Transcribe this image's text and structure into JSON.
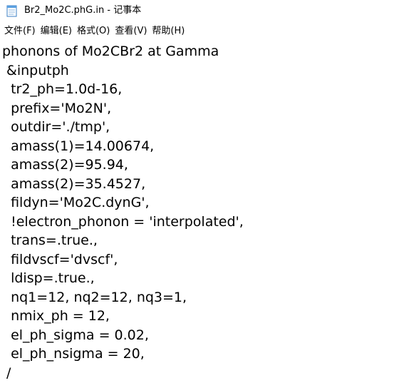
{
  "window": {
    "title": "Br2_Mo2C.phG.in - 记事本",
    "icon": "notepad-icon"
  },
  "menu": [
    {
      "label": "文件(F)"
    },
    {
      "label": "编辑(E)"
    },
    {
      "label": "格式(O)"
    },
    {
      "label": "查看(V)"
    },
    {
      "label": "帮助(H)"
    }
  ],
  "document": {
    "lines": [
      "phonons of Mo2CBr2 at Gamma",
      " &inputph",
      "  tr2_ph=1.0d-16,",
      "  prefix='Mo2N',",
      "  outdir='./tmp',",
      "  amass(1)=14.00674,",
      "  amass(2)=95.94,",
      "  amass(2)=35.4527,",
      "  fildyn='Mo2C.dynG',",
      "  !electron_phonon = 'interpolated',",
      "  trans=.true.,",
      "  fildvscf='dvscf',",
      "  ldisp=.true.,",
      "  nq1=12, nq2=12, nq3=1,",
      "  nmix_ph = 12,",
      "  el_ph_sigma = 0.02,",
      "  el_ph_nsigma = 20,",
      " /"
    ]
  }
}
